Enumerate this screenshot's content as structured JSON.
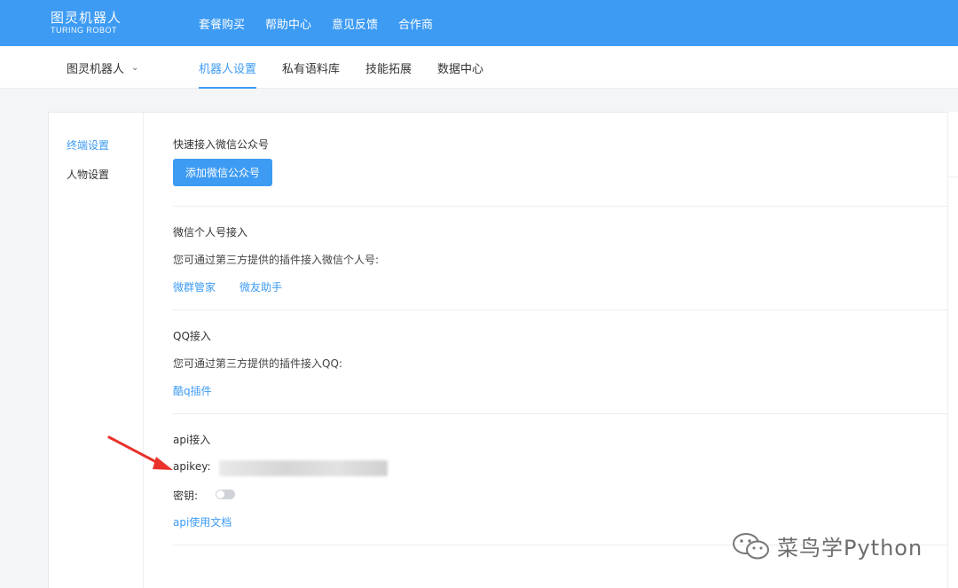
{
  "header": {
    "logo_cn": "图灵机器人",
    "logo_en": "TURING ROBOT",
    "nav": [
      "套餐购买",
      "帮助中心",
      "意见反馈",
      "合作商"
    ]
  },
  "subheader": {
    "robot_name": "图灵机器人",
    "tabs": [
      "机器人设置",
      "私有语料库",
      "技能拓展",
      "数据中心"
    ],
    "active_tab": "机器人设置"
  },
  "sidebar": {
    "items": [
      "终端设置",
      "人物设置"
    ],
    "active": "终端设置"
  },
  "sections": {
    "wechat_official": {
      "title": "快速接入微信公众号",
      "button": "添加微信公众号"
    },
    "wechat_personal": {
      "title": "微信个人号接入",
      "desc": "您可通过第三方提供的插件接入微信个人号:",
      "links": [
        "微群管家",
        "微友助手"
      ]
    },
    "qq": {
      "title": "QQ接入",
      "desc": "您可通过第三方提供的插件接入QQ:",
      "links": [
        "酷q插件"
      ]
    },
    "api": {
      "title": "api接入",
      "apikey_label": "apikey:",
      "secret_label": "密钥:",
      "secret_enabled": false,
      "doc_link": "api使用文档"
    }
  },
  "watermark": {
    "text": "菜鸟学Python"
  },
  "colors": {
    "primary": "#3d9bf3",
    "arrow": "#e8322b"
  }
}
